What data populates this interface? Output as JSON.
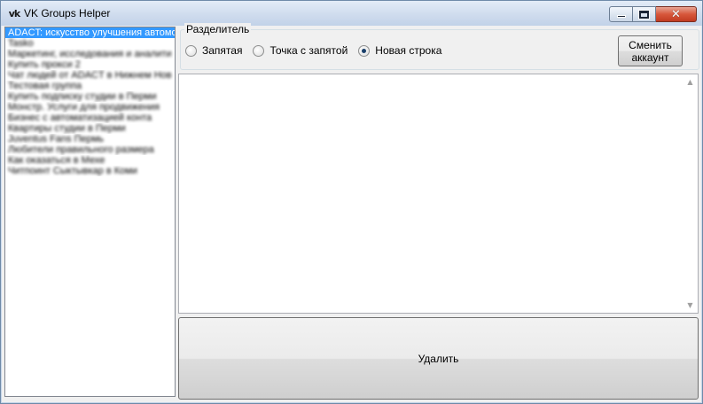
{
  "window": {
    "title": "VK Groups Helper",
    "icon_text": "vk",
    "minimize_label": "Minimize",
    "maximize_label": "Maximize",
    "close_glyph": "✕"
  },
  "groups": {
    "items": [
      {
        "label": "ADACT: искусство улучшения автомо",
        "selected": true,
        "blurred": false
      },
      {
        "label": "Tasko",
        "selected": false,
        "blurred": true
      },
      {
        "label": "Маркетинг, исследования и аналити",
        "selected": false,
        "blurred": true
      },
      {
        "label": "Купить прокси 2",
        "selected": false,
        "blurred": true
      },
      {
        "label": "Чат людей от ADACT в Нижнем Нов",
        "selected": false,
        "blurred": true
      },
      {
        "label": "Тестовая группа",
        "selected": false,
        "blurred": true
      },
      {
        "label": "Купить подписку студии в Перми",
        "selected": false,
        "blurred": true
      },
      {
        "label": "Монстр. Услуги для продвижения",
        "selected": false,
        "blurred": true
      },
      {
        "label": "Бизнес с автоматизацией конта",
        "selected": false,
        "blurred": true
      },
      {
        "label": "Квартиры студии в Перми",
        "selected": false,
        "blurred": true
      },
      {
        "label": "Juventus Fans Пермь",
        "selected": false,
        "blurred": true
      },
      {
        "label": "Любители правильного размера",
        "selected": false,
        "blurred": true
      },
      {
        "label": "Как оказаться в Мехе",
        "selected": false,
        "blurred": true
      },
      {
        "label": "Читпоинт Сыктывкар в Коми",
        "selected": false,
        "blurred": true
      }
    ]
  },
  "separator": {
    "caption": "Разделитель",
    "options": [
      {
        "label": "Запятая",
        "checked": false
      },
      {
        "label": "Точка с запятой",
        "checked": false
      },
      {
        "label": "Новая строка",
        "checked": true
      }
    ]
  },
  "actions": {
    "switch_account": "Сменить\nаккаунт",
    "delete": "Удалить"
  },
  "editor": {
    "value": ""
  },
  "scrollbar": {
    "up_glyph": "▲",
    "down_glyph": "▼"
  }
}
